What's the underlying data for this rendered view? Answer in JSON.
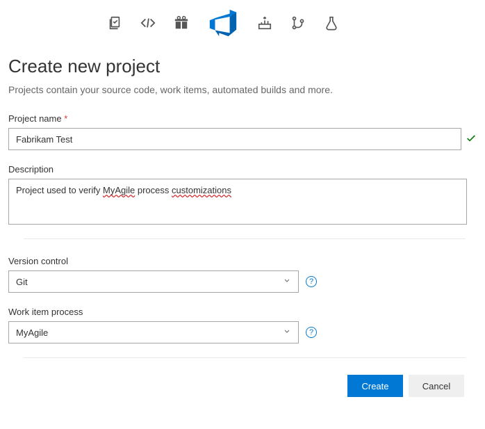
{
  "header_icons": {
    "boards": "boards-icon",
    "code": "code-icon",
    "gift": "gift-icon",
    "devops": "devops-icon",
    "pipelines": "pipelines-icon",
    "repos": "repos-icon",
    "test": "test-icon"
  },
  "page": {
    "title": "Create new project",
    "subtitle": "Projects contain your source code, work items, automated builds and more."
  },
  "form": {
    "project_name": {
      "label": "Project name",
      "required_marker": "*",
      "value": "Fabrikam Test",
      "valid": true
    },
    "description": {
      "label": "Description",
      "value_pre": "Project used to verify ",
      "value_sq1": "MyAgile",
      "value_mid": " process ",
      "value_sq2": "customizations"
    },
    "version_control": {
      "label": "Version control",
      "value": "Git",
      "help": "?"
    },
    "work_item_process": {
      "label": "Work item process",
      "value": "MyAgile",
      "help": "?"
    }
  },
  "buttons": {
    "create": "Create",
    "cancel": "Cancel"
  }
}
